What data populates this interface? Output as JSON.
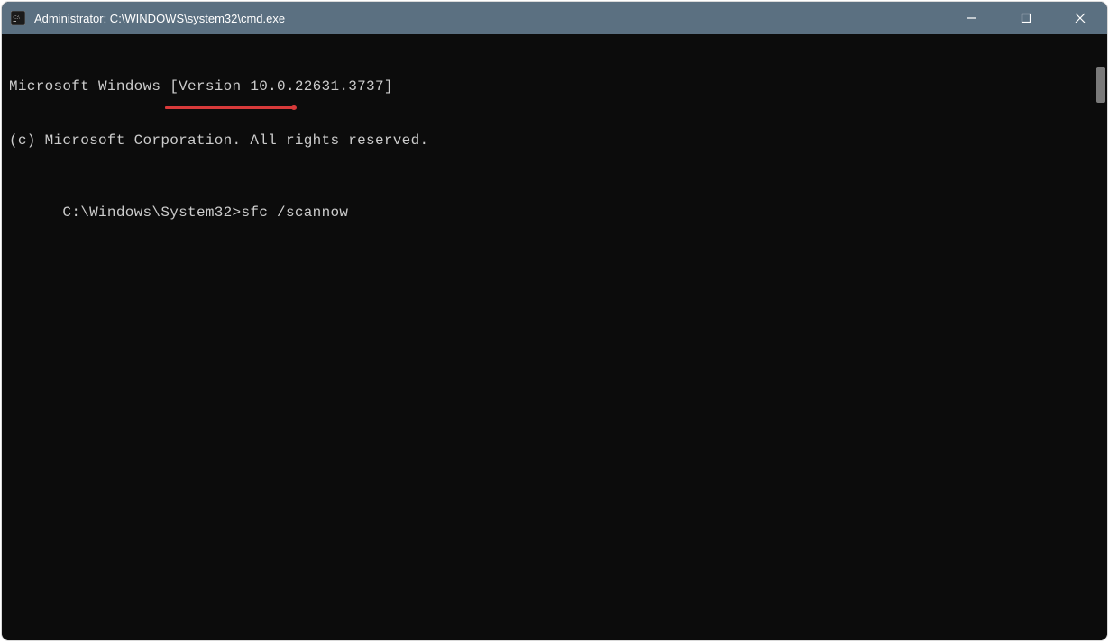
{
  "window": {
    "title": "Administrator: C:\\WINDOWS\\system32\\cmd.exe"
  },
  "terminal": {
    "line1": "Microsoft Windows [Version 10.0.22631.3737]",
    "line2": "(c) Microsoft Corporation. All rights reserved.",
    "blank": "",
    "prompt": "C:\\Windows\\System32>",
    "command": "sfc /scannow"
  },
  "annotation": {
    "underline_color": "#d93a3a"
  }
}
